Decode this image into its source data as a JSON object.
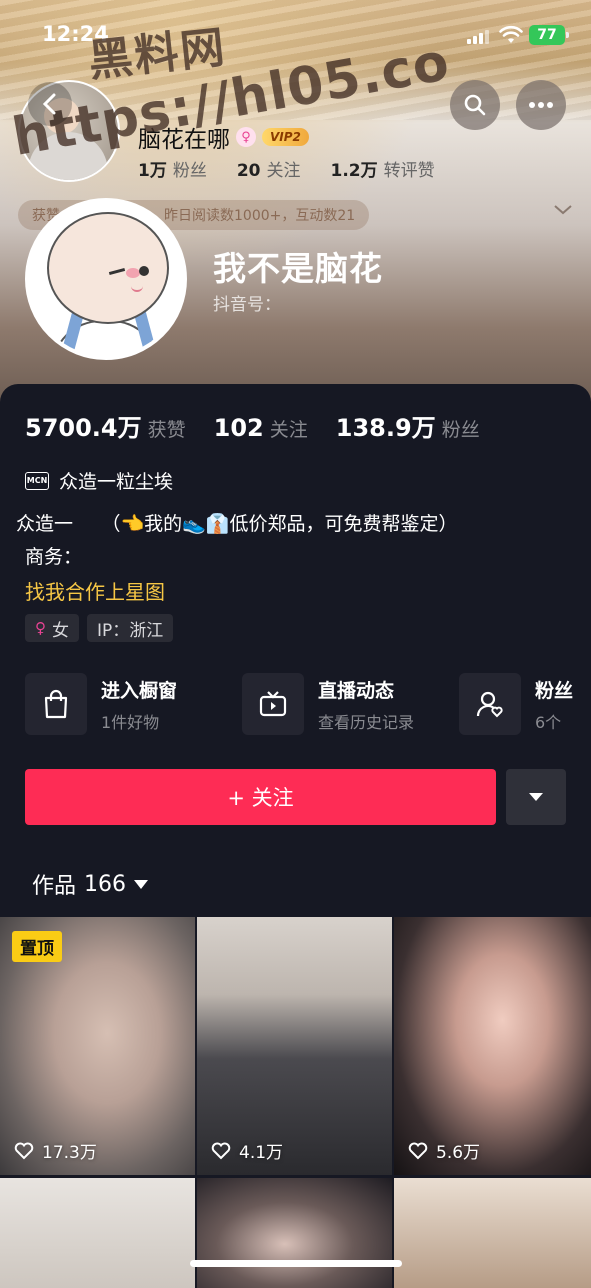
{
  "status_bar": {
    "time": "12:24",
    "battery": "77"
  },
  "watermark": {
    "line1": "黑料网",
    "line2": "https://hl05.co"
  },
  "header": {
    "mini_name": "脑花在哪",
    "vip_label": "VIP2",
    "mini_stats": [
      {
        "value": "1万",
        "label": "粉丝"
      },
      {
        "value": "20",
        "label": "关注"
      },
      {
        "value": "1.2万",
        "label": "转评赞"
      }
    ],
    "activity_text_left": "获赞",
    "activity_text_right": "昨日阅读数1000+，互动数21"
  },
  "profile": {
    "name": "我不是脑花",
    "douyin_id_label": "抖音号："
  },
  "stats": [
    {
      "value": "5700.4万",
      "label": "获赞"
    },
    {
      "value": "102",
      "label": "关注"
    },
    {
      "value": "138.9万",
      "label": "粉丝"
    }
  ],
  "mcn": {
    "badge": "MCN",
    "name": "众造一粒尘埃"
  },
  "bio": {
    "line1": "众造一　　（👈我的👟👔低价郑品，可免费帮鉴定）",
    "business_label": "商务：",
    "star_link": "找我合作上星图"
  },
  "tags": [
    {
      "icon": "female-icon",
      "text": "女"
    },
    {
      "text": "IP：浙江"
    }
  ],
  "entries": [
    {
      "icon": "shopping-bag-icon",
      "title": "进入橱窗",
      "subtitle": "1件好物"
    },
    {
      "icon": "tv-icon",
      "title": "直播动态",
      "subtitle": "查看历史记录"
    },
    {
      "icon": "fan-group-icon",
      "title": "粉丝",
      "subtitle": "6个"
    }
  ],
  "follow_button": "+ 关注",
  "works": {
    "label": "作品",
    "count": "166"
  },
  "videos": [
    {
      "pinned": "置顶",
      "likes": "17.3万"
    },
    {
      "likes": "4.1万"
    },
    {
      "likes": "5.6万"
    }
  ],
  "colors": {
    "accent": "#fe2c55",
    "background": "#161823",
    "link": "#f5c645",
    "pin": "#facc15"
  }
}
